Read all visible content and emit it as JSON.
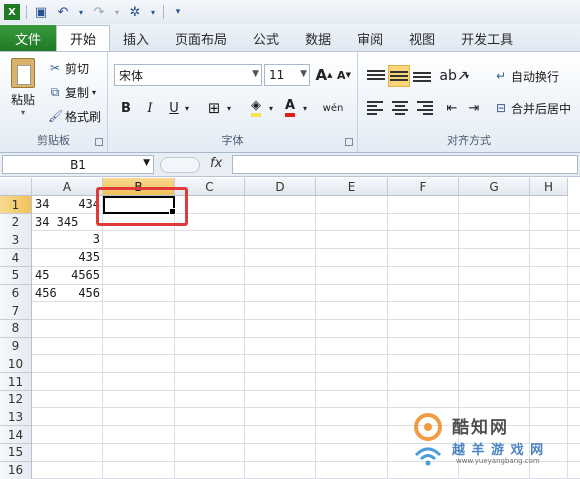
{
  "qat": {
    "icons": [
      "save-icon",
      "undo-icon",
      "redo-icon",
      "wand-icon"
    ]
  },
  "tabs": [
    {
      "label": "文件",
      "active": false
    },
    {
      "label": "开始",
      "active": true
    },
    {
      "label": "插入",
      "active": false
    },
    {
      "label": "页面布局",
      "active": false
    },
    {
      "label": "公式",
      "active": false
    },
    {
      "label": "数据",
      "active": false
    },
    {
      "label": "审阅",
      "active": false
    },
    {
      "label": "视图",
      "active": false
    },
    {
      "label": "开发工具",
      "active": false
    }
  ],
  "clipboard": {
    "paste_label": "粘贴",
    "cut_label": "剪切",
    "copy_label": "复制",
    "format_painter_label": "格式刷",
    "group_label": "剪贴板"
  },
  "font": {
    "name": "宋体",
    "size": "11",
    "grow": "A",
    "shrink": "A",
    "bold": "B",
    "italic": "I",
    "underline": "U",
    "font_color_glyph": "A",
    "phonetic_label": "wén",
    "group_label": "字体"
  },
  "alignment": {
    "wrap_text_label": "自动换行",
    "merge_center_label": "合并后居中",
    "group_label": "对齐方式"
  },
  "formula_bar": {
    "name_box": "B1",
    "fx": "fx",
    "value": ""
  },
  "sheet": {
    "columns": [
      "A",
      "B",
      "C",
      "D",
      "E",
      "F",
      "G",
      "H"
    ],
    "selected_column": "B",
    "rows": [
      "1",
      "2",
      "3",
      "4",
      "5",
      "6",
      "7",
      "8",
      "9",
      "10",
      "11",
      "12",
      "13",
      "14",
      "15",
      "16"
    ],
    "selected_row": "1",
    "cells_A": [
      {
        "left": "34",
        "right": "434"
      },
      {
        "left": "34 345",
        "right": ""
      },
      {
        "left": "",
        "right": "3"
      },
      {
        "left": "",
        "right": "435"
      },
      {
        "left": "45",
        "right": "4565"
      },
      {
        "left": "456",
        "right": "456"
      }
    ]
  },
  "watermark": {
    "line1": "酷知网",
    "line2": "越 羊 游 戏 网",
    "line3": "www.yueyangbang.com"
  },
  "colors": {
    "file_tab": "#1f7a24",
    "selection": "#f2c25a",
    "highlight_box": "#e23a3a"
  }
}
